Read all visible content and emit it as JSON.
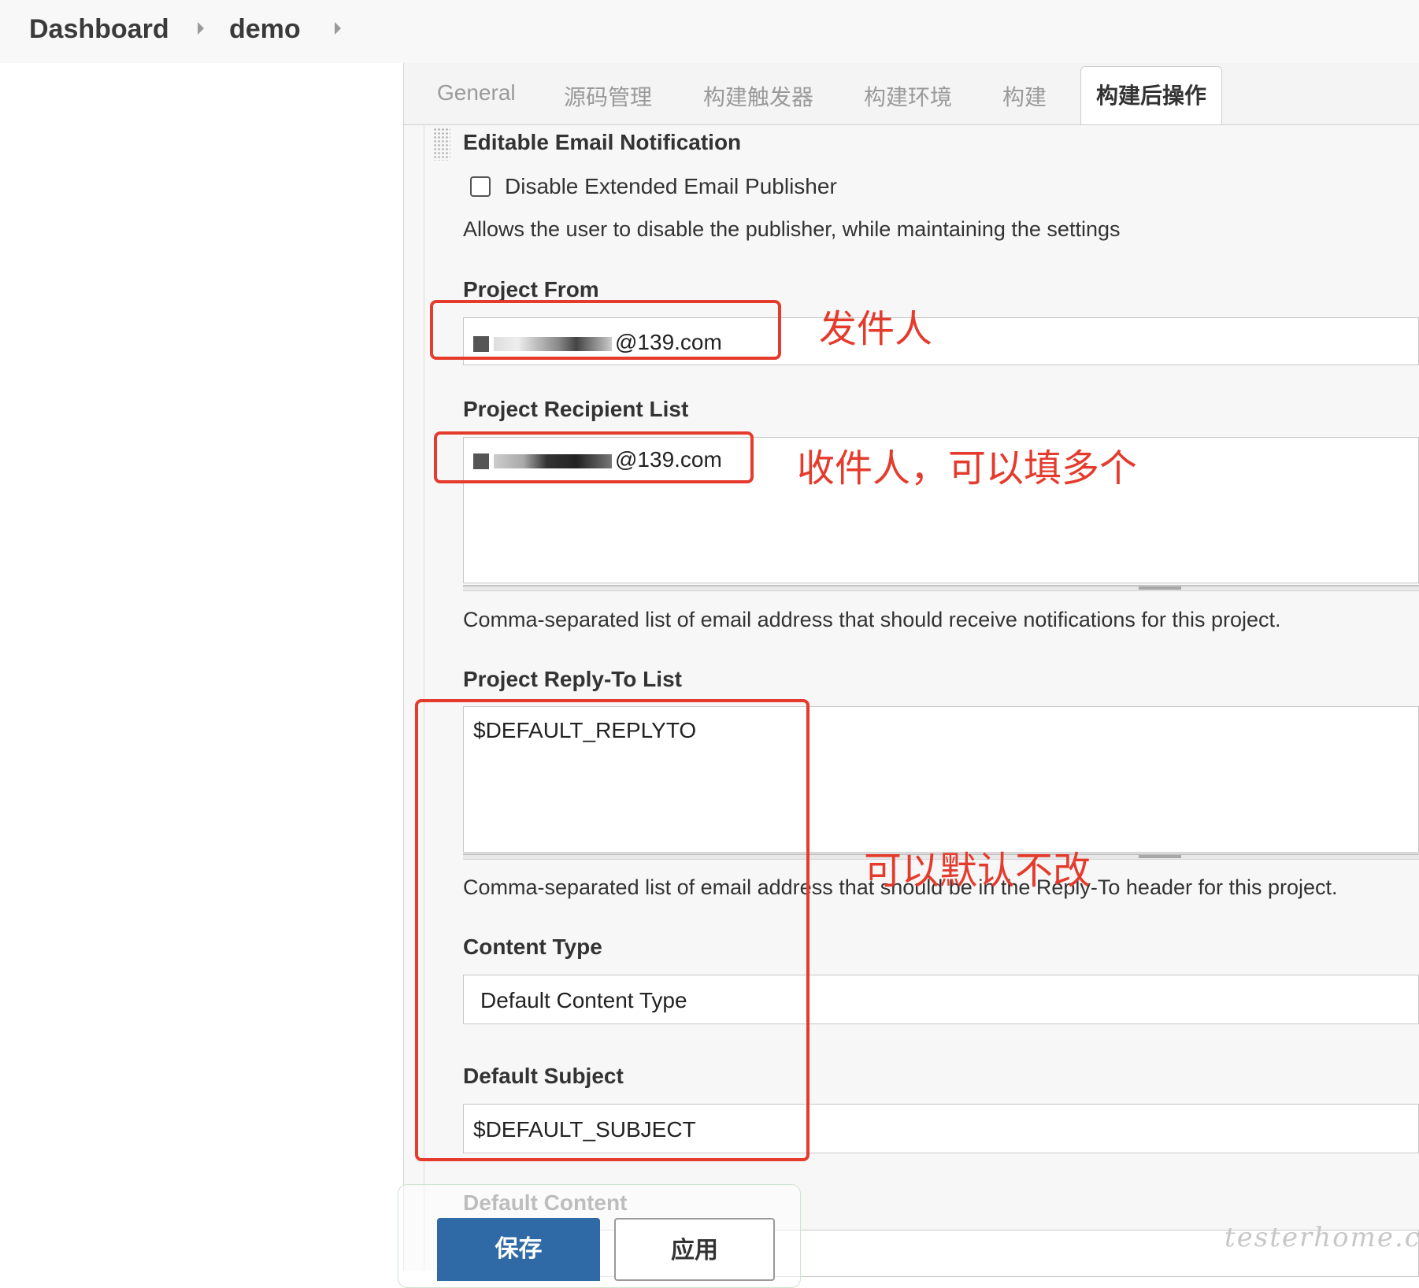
{
  "breadcrumb": {
    "dashboard": "Dashboard",
    "job": "demo"
  },
  "tabs": [
    "General",
    "源码管理",
    "构建触发器",
    "构建环境",
    "构建"
  ],
  "active_tab": "构建后操作",
  "section": {
    "title": "Editable Email Notification",
    "disable_checkbox_label": "Disable Extended Email Publisher",
    "disable_checkbox_checked": false,
    "disable_description": "Allows the user to disable the publisher, while maintaining the settings",
    "project_from": {
      "label": "Project From",
      "value_suffix": "@139.com"
    },
    "recipient_list": {
      "label": "Project Recipient List",
      "value_suffix": "@139.com",
      "help": "Comma-separated list of email address that should receive notifications for this project."
    },
    "reply_to": {
      "label": "Project Reply-To List",
      "value": "$DEFAULT_REPLYTO",
      "help": "Comma-separated list of email address that should be in the Reply-To header for this project."
    },
    "content_type": {
      "label": "Content Type",
      "selected": "Default Content Type"
    },
    "default_subject": {
      "label": "Default Subject",
      "value": "$DEFAULT_SUBJECT"
    },
    "default_content": {
      "label": "Default Content"
    }
  },
  "annotations": {
    "from_note": "发件人",
    "recipient_note": "收件人，可以填多个",
    "default_note": "可以默认不改"
  },
  "buttons": {
    "save": "保存",
    "apply": "应用"
  },
  "watermark": "testerhome.com",
  "colors": {
    "annotation": "#e53b2c",
    "save_button": "#2f6aa6"
  }
}
